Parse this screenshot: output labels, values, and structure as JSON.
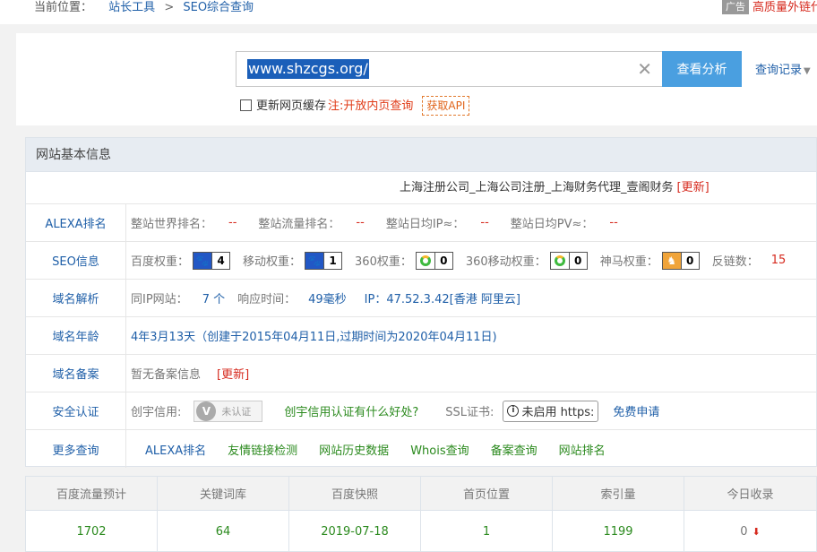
{
  "breadcrumb": {
    "prefix": "当前位置：",
    "items": [
      "站长工具",
      "SEO综合查询"
    ],
    "separator": ">"
  },
  "ad": {
    "tag": "广告",
    "text": "高质量外链代"
  },
  "search": {
    "value": "www.shzcgs.org/",
    "button": "查看分析",
    "history": "查询记录",
    "cache_label": "更新网页缓存",
    "note_label": "注:",
    "note_text": "开放内页查询",
    "api_button": "获取API"
  },
  "info": {
    "header": "网站基本信息",
    "site_title": "上海注册公司_上海公司注册_上海财务代理_壹阁财务",
    "site_refresh": "[更新]",
    "alexa": {
      "label": "ALEXA排名",
      "world_k": "整站世界排名：",
      "world_v": "--",
      "traffic_k": "整站流量排名：",
      "traffic_v": "--",
      "ip_k": "整站日均IP≈：",
      "ip_v": "--",
      "pv_k": "整站日均PV≈：",
      "pv_v": "--"
    },
    "seo": {
      "label": "SEO信息",
      "baidu_k": "百度权重：",
      "baidu_v": "4",
      "mobile_k": "移动权重：",
      "mobile_v": "1",
      "s360_k": "360权重：",
      "s360_v": "0",
      "s360m_k": "360移动权重：",
      "s360m_v": "0",
      "shenma_k": "神马权重：",
      "shenma_v": "0",
      "backlink_k": "反链数：",
      "backlink_v": "15"
    },
    "dns": {
      "label": "域名解析",
      "sameip_k": "同IP网站：",
      "sameip_v": "7 个",
      "resp_k": "响应时间：",
      "resp_v": "49毫秒",
      "ip": "IP：47.52.3.42[香港 阿里云]"
    },
    "age": {
      "label": "域名年龄",
      "text": "4年3月13天（创建于2015年04月11日,过期时间为2020年04月11日)"
    },
    "icp": {
      "label": "域名备案",
      "text": "暂无备案信息",
      "refresh": "[更新]"
    },
    "security": {
      "label": "安全认证",
      "cred_k": "创宇信用:",
      "cred_badge": "未认证",
      "cred_link": "创宇信用认证有什么好处?",
      "ssl_k": "SSL证书:",
      "ssl_btn": "未启用 https:",
      "ssl_link": "免费申请"
    },
    "more": {
      "label": "更多查询",
      "links": [
        "ALEXA排名",
        "友情链接检测",
        "网站历史数据",
        "Whois查询",
        "备案查询",
        "网站排名"
      ]
    }
  },
  "stats": {
    "headers": [
      "百度流量预计",
      "关键词库",
      "百度快照",
      "首页位置",
      "索引量",
      "今日收录"
    ],
    "values": [
      "1702",
      "64",
      "2019-07-18",
      "1",
      "1199",
      "0"
    ]
  },
  "colors": {
    "accent": "#4a9fe0",
    "link": "#1f5fa8",
    "red": "#d62a1e",
    "green": "#2b8a1e"
  },
  "icons": [
    "clear-icon",
    "caret-down-icon",
    "paw-icon",
    "ring-icon",
    "shenma-icon",
    "verify-icon",
    "info-icon",
    "down-arrow-icon"
  ]
}
